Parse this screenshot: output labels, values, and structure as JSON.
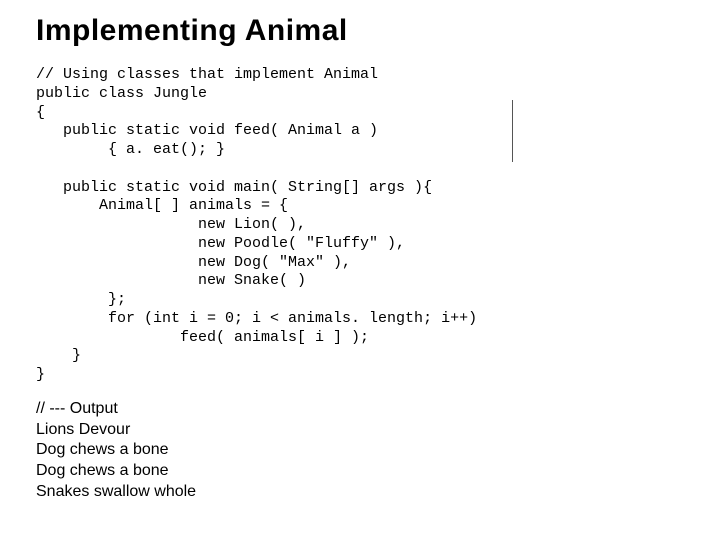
{
  "title": "Implementing Animal",
  "code": "// Using classes that implement Animal\npublic class Jungle\n{\n   public static void feed( Animal a )\n        { a. eat(); }\n\n   public static void main( String[] args ){\n       Animal[ ] animals = {\n                  new Lion( ),\n                  new Poodle( \"Fluffy\" ),\n                  new Dog( \"Max\" ),\n                  new Snake( )\n        };\n        for (int i = 0; i < animals. length; i++)\n                feed( animals[ i ] );\n    }\n}",
  "output": "// --- Output\nLions Devour\nDog chews a bone\nDog chews a bone\nSnakes swallow whole"
}
